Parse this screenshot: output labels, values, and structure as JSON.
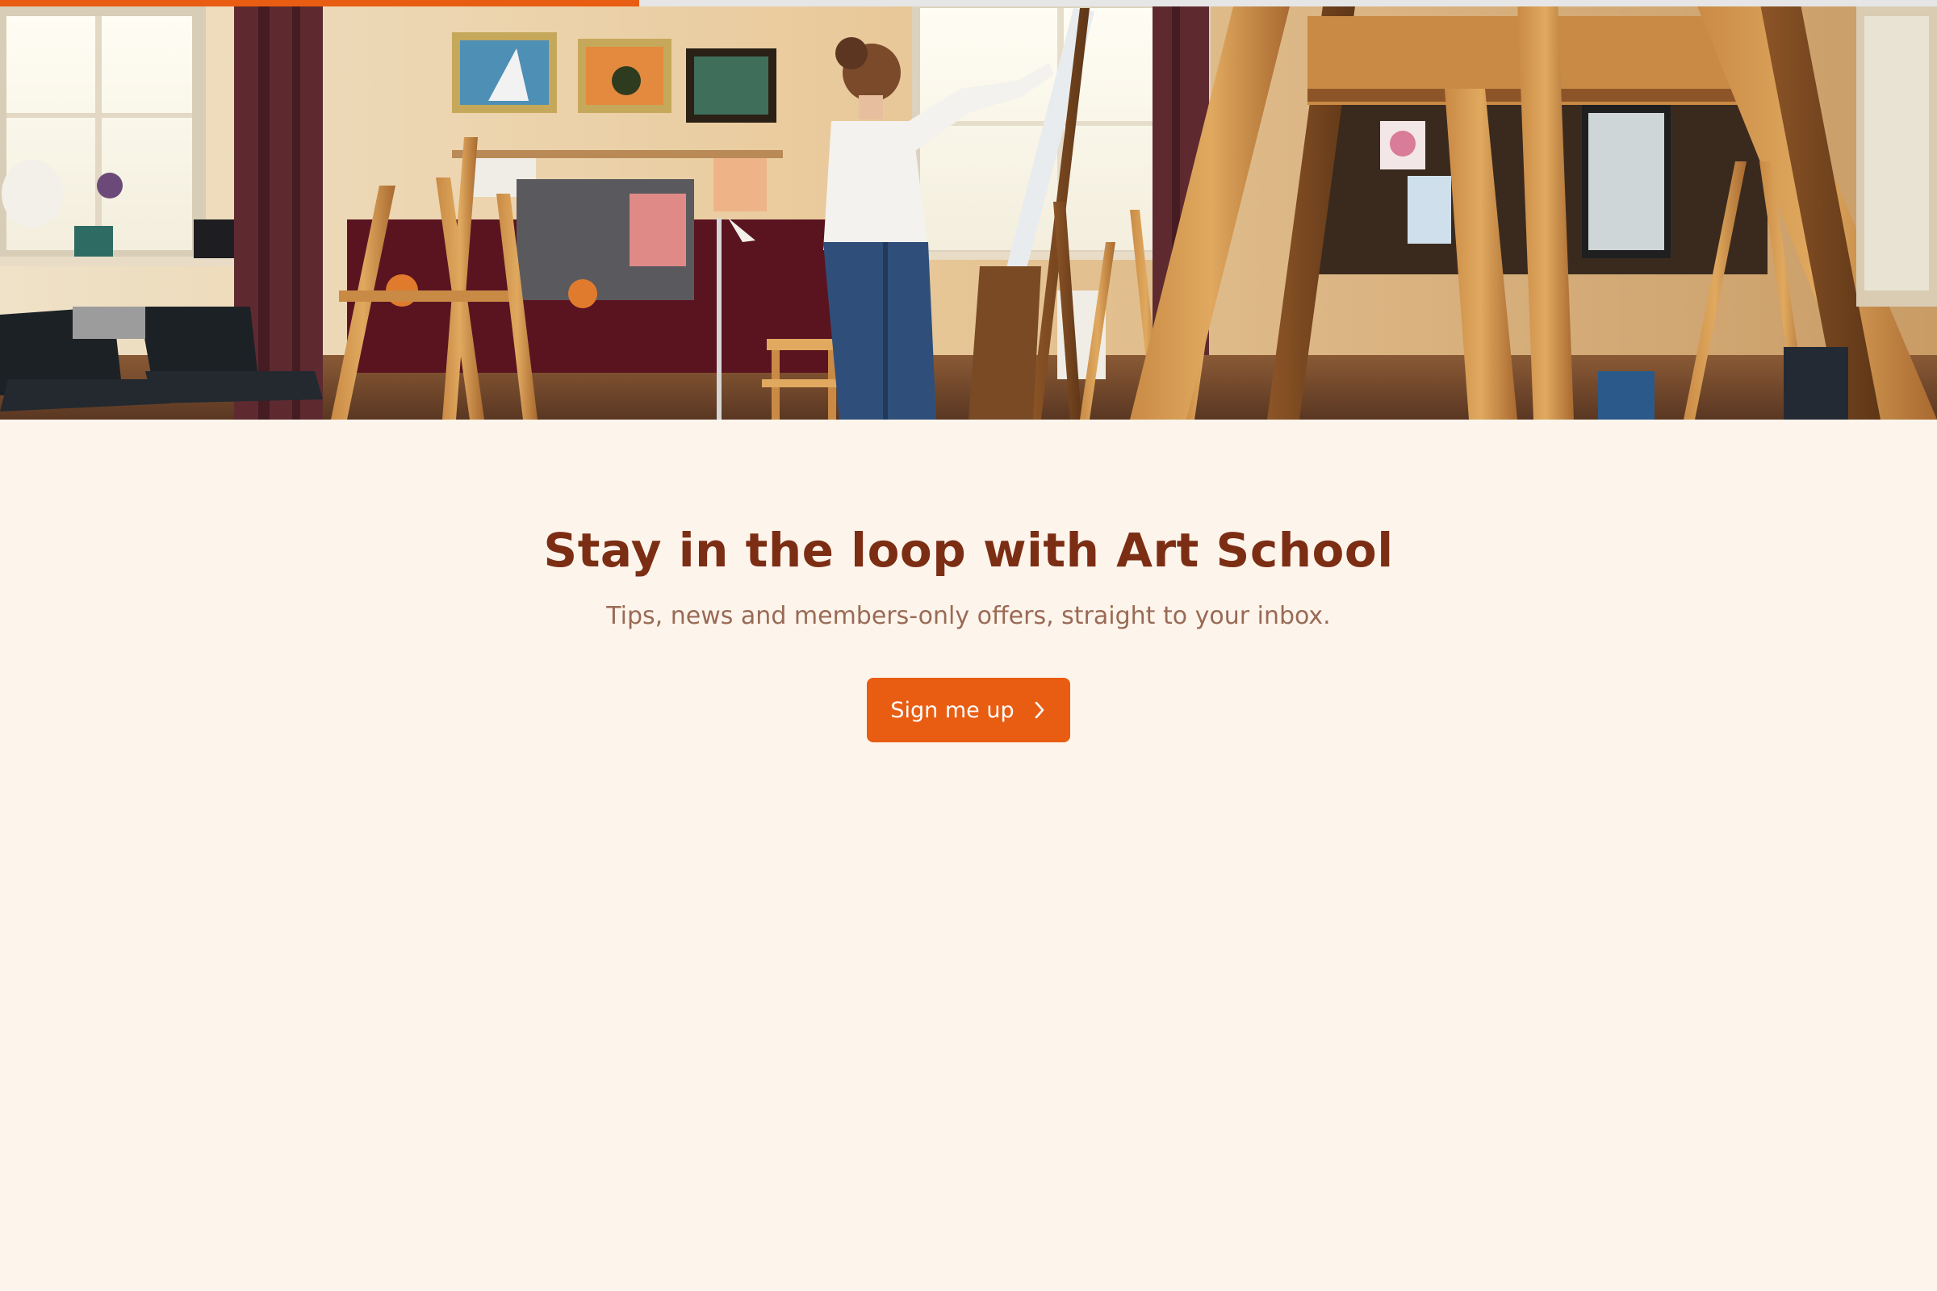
{
  "progress": {
    "value_percent": 33,
    "color": "#e85d12",
    "track_color": "#e6e6e6"
  },
  "hero": {
    "image": "art-studio-photo"
  },
  "newsletter": {
    "title": "Stay in the loop with Art School",
    "subtitle": "Tips, news and members-only offers, straight to your inbox.",
    "cta_label": "Sign me up",
    "cta_icon": "chevron-right-icon"
  },
  "colors": {
    "background": "#fdf5ec",
    "title": "#7c2e14",
    "subtitle": "#9a6a55",
    "accent": "#e85d12"
  }
}
